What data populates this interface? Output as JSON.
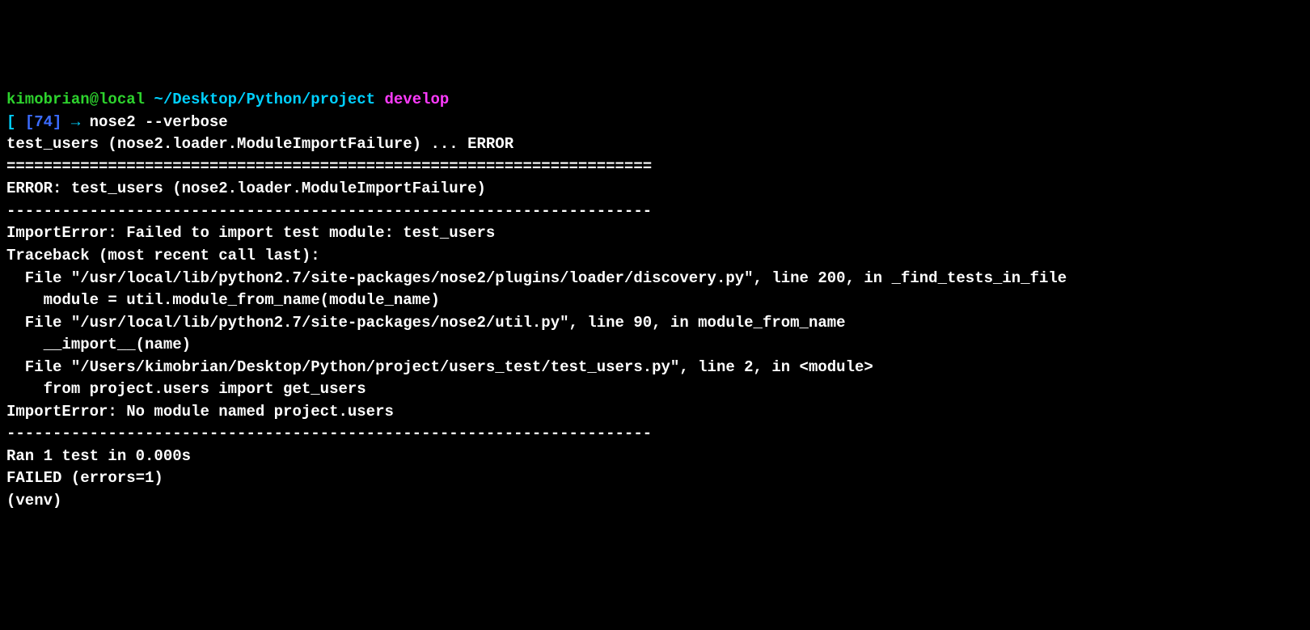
{
  "prompt1": {
    "user_host": "kimobrian@local",
    "path": " ~/Desktop/Python/project ",
    "branch": "develop"
  },
  "prompt2": {
    "bracket_open": "[ ",
    "number": "[74]",
    "arrow": " → ",
    "command": "nose2 --verbose"
  },
  "out": {
    "l1": "test_users (nose2.loader.ModuleImportFailure) ... ERROR",
    "l2": "",
    "l3": "======================================================================",
    "l4": "ERROR: test_users (nose2.loader.ModuleImportFailure)",
    "l5": "----------------------------------------------------------------------",
    "l6": "ImportError: Failed to import test module: test_users",
    "l7": "Traceback (most recent call last):",
    "l8": "  File \"/usr/local/lib/python2.7/site-packages/nose2/plugins/loader/discovery.py\", line 200, in _find_tests_in_file",
    "l9": "    module = util.module_from_name(module_name)",
    "l10": "  File \"/usr/local/lib/python2.7/site-packages/nose2/util.py\", line 90, in module_from_name",
    "l11": "    __import__(name)",
    "l12": "  File \"/Users/kimobrian/Desktop/Python/project/users_test/test_users.py\", line 2, in <module>",
    "l13": "    from project.users import get_users",
    "l14": "ImportError: No module named project.users",
    "l15": "",
    "l16": "",
    "l17": "----------------------------------------------------------------------",
    "l18": "Ran 1 test in 0.000s",
    "l19": "",
    "l20": "FAILED (errors=1)",
    "l21": "(venv)"
  }
}
